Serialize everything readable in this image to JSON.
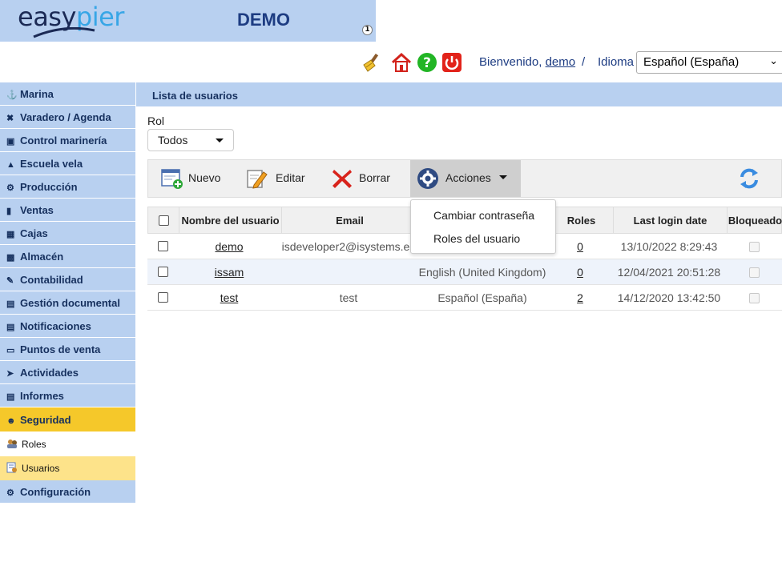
{
  "header": {
    "logo_easy": "easy",
    "logo_pier": "pier",
    "title": "DEMO",
    "badge": "1",
    "welcome_prefix": "Bienvenido,",
    "user": "demo",
    "separator": "/",
    "idioma_label": "Idioma",
    "language_value": "Español (España)"
  },
  "sidebar": {
    "items": [
      {
        "label": "Marina",
        "icon": "ship-icon"
      },
      {
        "label": "Varadero / Agenda",
        "icon": "tools-icon"
      },
      {
        "label": "Control marinería",
        "icon": "clipboard-icon"
      },
      {
        "label": "Escuela vela",
        "icon": "graduation-cap-icon"
      },
      {
        "label": "Producción",
        "icon": "wrench-icon"
      },
      {
        "label": "Ventas",
        "icon": "file-icon"
      },
      {
        "label": "Cajas",
        "icon": "cash-register-icon"
      },
      {
        "label": "Almacén",
        "icon": "boxes-icon"
      },
      {
        "label": "Contabilidad",
        "icon": "pen-icon"
      },
      {
        "label": "Gestión documental",
        "icon": "document-icon"
      },
      {
        "label": "Notificaciones",
        "icon": "inbox-icon"
      },
      {
        "label": "Puntos de venta",
        "icon": "monitor-icon"
      },
      {
        "label": "Actividades",
        "icon": "fish-icon"
      },
      {
        "label": "Informes",
        "icon": "report-icon"
      }
    ],
    "security": {
      "label": "Seguridad",
      "icon": "user-edit-icon"
    },
    "security_sub": [
      {
        "label": "Roles",
        "icon": "roles-icon"
      },
      {
        "label": "Usuarios",
        "icon": "users-icon"
      }
    ],
    "config": {
      "label": "Configuración",
      "icon": "gear-icon"
    }
  },
  "main": {
    "section_title": "Lista de usuarios",
    "rol_label": "Rol",
    "rol_value": "Todos",
    "toolbar": {
      "nuevo": "Nuevo",
      "editar": "Editar",
      "borrar": "Borrar",
      "acciones": "Acciones"
    },
    "acciones_menu": [
      "Cambiar contraseña",
      "Roles del usuario"
    ],
    "columns": [
      "Nombre del usuario",
      "Email",
      "Roles",
      "Last login date",
      "Bloqueado"
    ],
    "rows": [
      {
        "name": "demo",
        "email": "isdeveloper2@isystems.es",
        "language": "",
        "roles": "0",
        "last_login": "13/10/2022 8:29:43"
      },
      {
        "name": "issam",
        "email": "",
        "language": "English (United Kingdom)",
        "roles": "0",
        "last_login": "12/04/2021 20:51:28"
      },
      {
        "name": "test",
        "email": "test",
        "language": "Español (España)",
        "roles": "2",
        "last_login": "14/12/2020 13:42:50"
      }
    ]
  },
  "colors": {
    "header_blue": "#b8d0f0",
    "title_blue": "#1d3c82",
    "active_yellow": "#f5c82a",
    "highlight_yellow": "#fde38a"
  }
}
